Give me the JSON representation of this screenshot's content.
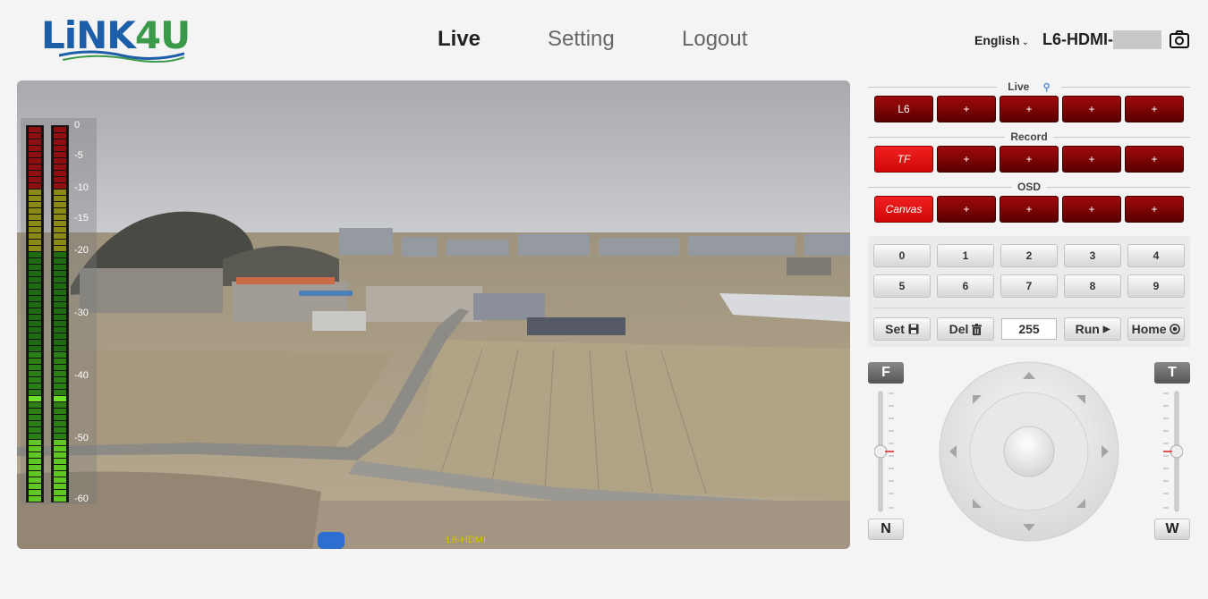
{
  "header": {
    "logo_text_1": "LiNK",
    "logo_text_2": "4U",
    "nav": [
      {
        "label": "Live",
        "active": true
      },
      {
        "label": "Setting",
        "active": false
      },
      {
        "label": "Logout",
        "active": false
      }
    ],
    "language": "English",
    "device_name": "L6-HDMI-",
    "camera_icon": "camera-icon"
  },
  "video": {
    "overlay_label": "L6-HDMI",
    "meter_ticks": [
      "0",
      "-5",
      "-10",
      "-15",
      "-20",
      "-30",
      "-40",
      "-50",
      "-60"
    ]
  },
  "panel": {
    "live": {
      "title": "Live",
      "icon": "person-icon",
      "buttons": [
        "L6",
        "+",
        "+",
        "+",
        "+"
      ]
    },
    "record": {
      "title": "Record",
      "buttons": [
        "TF",
        "+",
        "+",
        "+",
        "+"
      ]
    },
    "osd": {
      "title": "OSD",
      "buttons": [
        "Canvas",
        "+",
        "+",
        "+",
        "+"
      ]
    },
    "presets": {
      "numbers": [
        "0",
        "1",
        "2",
        "3",
        "4",
        "5",
        "6",
        "7",
        "8",
        "9"
      ],
      "set_label": "Set",
      "del_label": "Del",
      "value": "255",
      "run_label": "Run",
      "home_label": "Home"
    },
    "ptz": {
      "focus_far": "F",
      "focus_near": "N",
      "zoom_tele": "T",
      "zoom_wide": "W"
    }
  },
  "colors": {
    "brand_blue": "#1d5ea8",
    "brand_green": "#3b9a4a",
    "dark_red": "#8a0404",
    "bright_red": "#e01010"
  }
}
